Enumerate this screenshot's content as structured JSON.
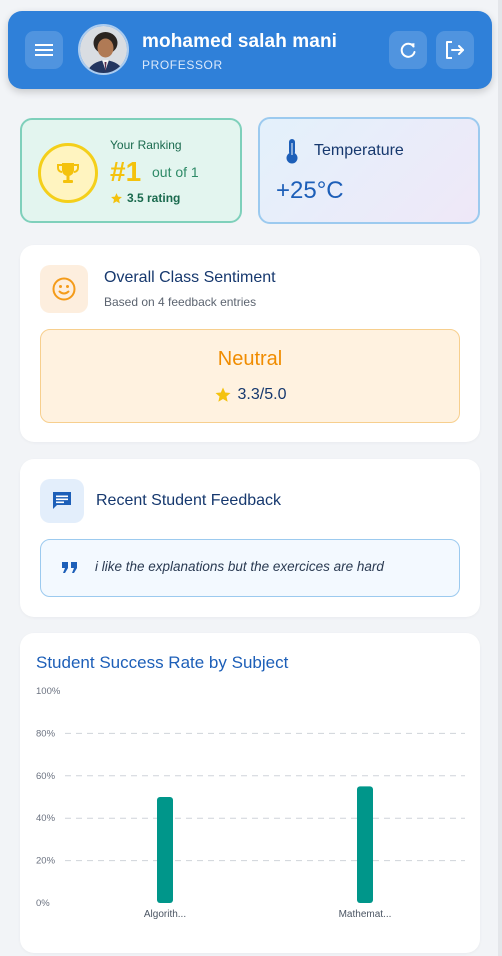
{
  "header": {
    "user_name": "mohamed salah mani",
    "user_role": "PROFESSOR",
    "icons": {
      "menu": "menu-icon",
      "refresh": "refresh-icon",
      "logout": "logout-icon"
    }
  },
  "ranking": {
    "title": "Your Ranking",
    "rank": "#1",
    "out_of": "out of 1",
    "rating": "3.5 rating"
  },
  "temperature": {
    "label": "Temperature",
    "value": "+25°C"
  },
  "sentiment": {
    "title": "Overall Class Sentiment",
    "subtitle": "Based on 4 feedback entries",
    "value": "Neutral",
    "score": "3.3/5.0"
  },
  "feedback": {
    "title": "Recent Student Feedback",
    "entries": [
      "i like the explanations but the exercices are hard"
    ]
  },
  "colors": {
    "header": "#2f80d9",
    "bar": "#00968a",
    "accent_orange": "#f08c00",
    "star": "#f4c20d"
  },
  "chart_data": {
    "type": "bar",
    "title": "Student Success Rate by Subject",
    "categories": [
      "Algorith...",
      "Mathemat..."
    ],
    "values": [
      50,
      55
    ],
    "ylim": [
      0,
      100
    ],
    "yticks": [
      0,
      20,
      40,
      60,
      80,
      100
    ],
    "ytick_labels": [
      "0%",
      "20%",
      "40%",
      "60%",
      "80%",
      "100%"
    ],
    "grid": true
  }
}
